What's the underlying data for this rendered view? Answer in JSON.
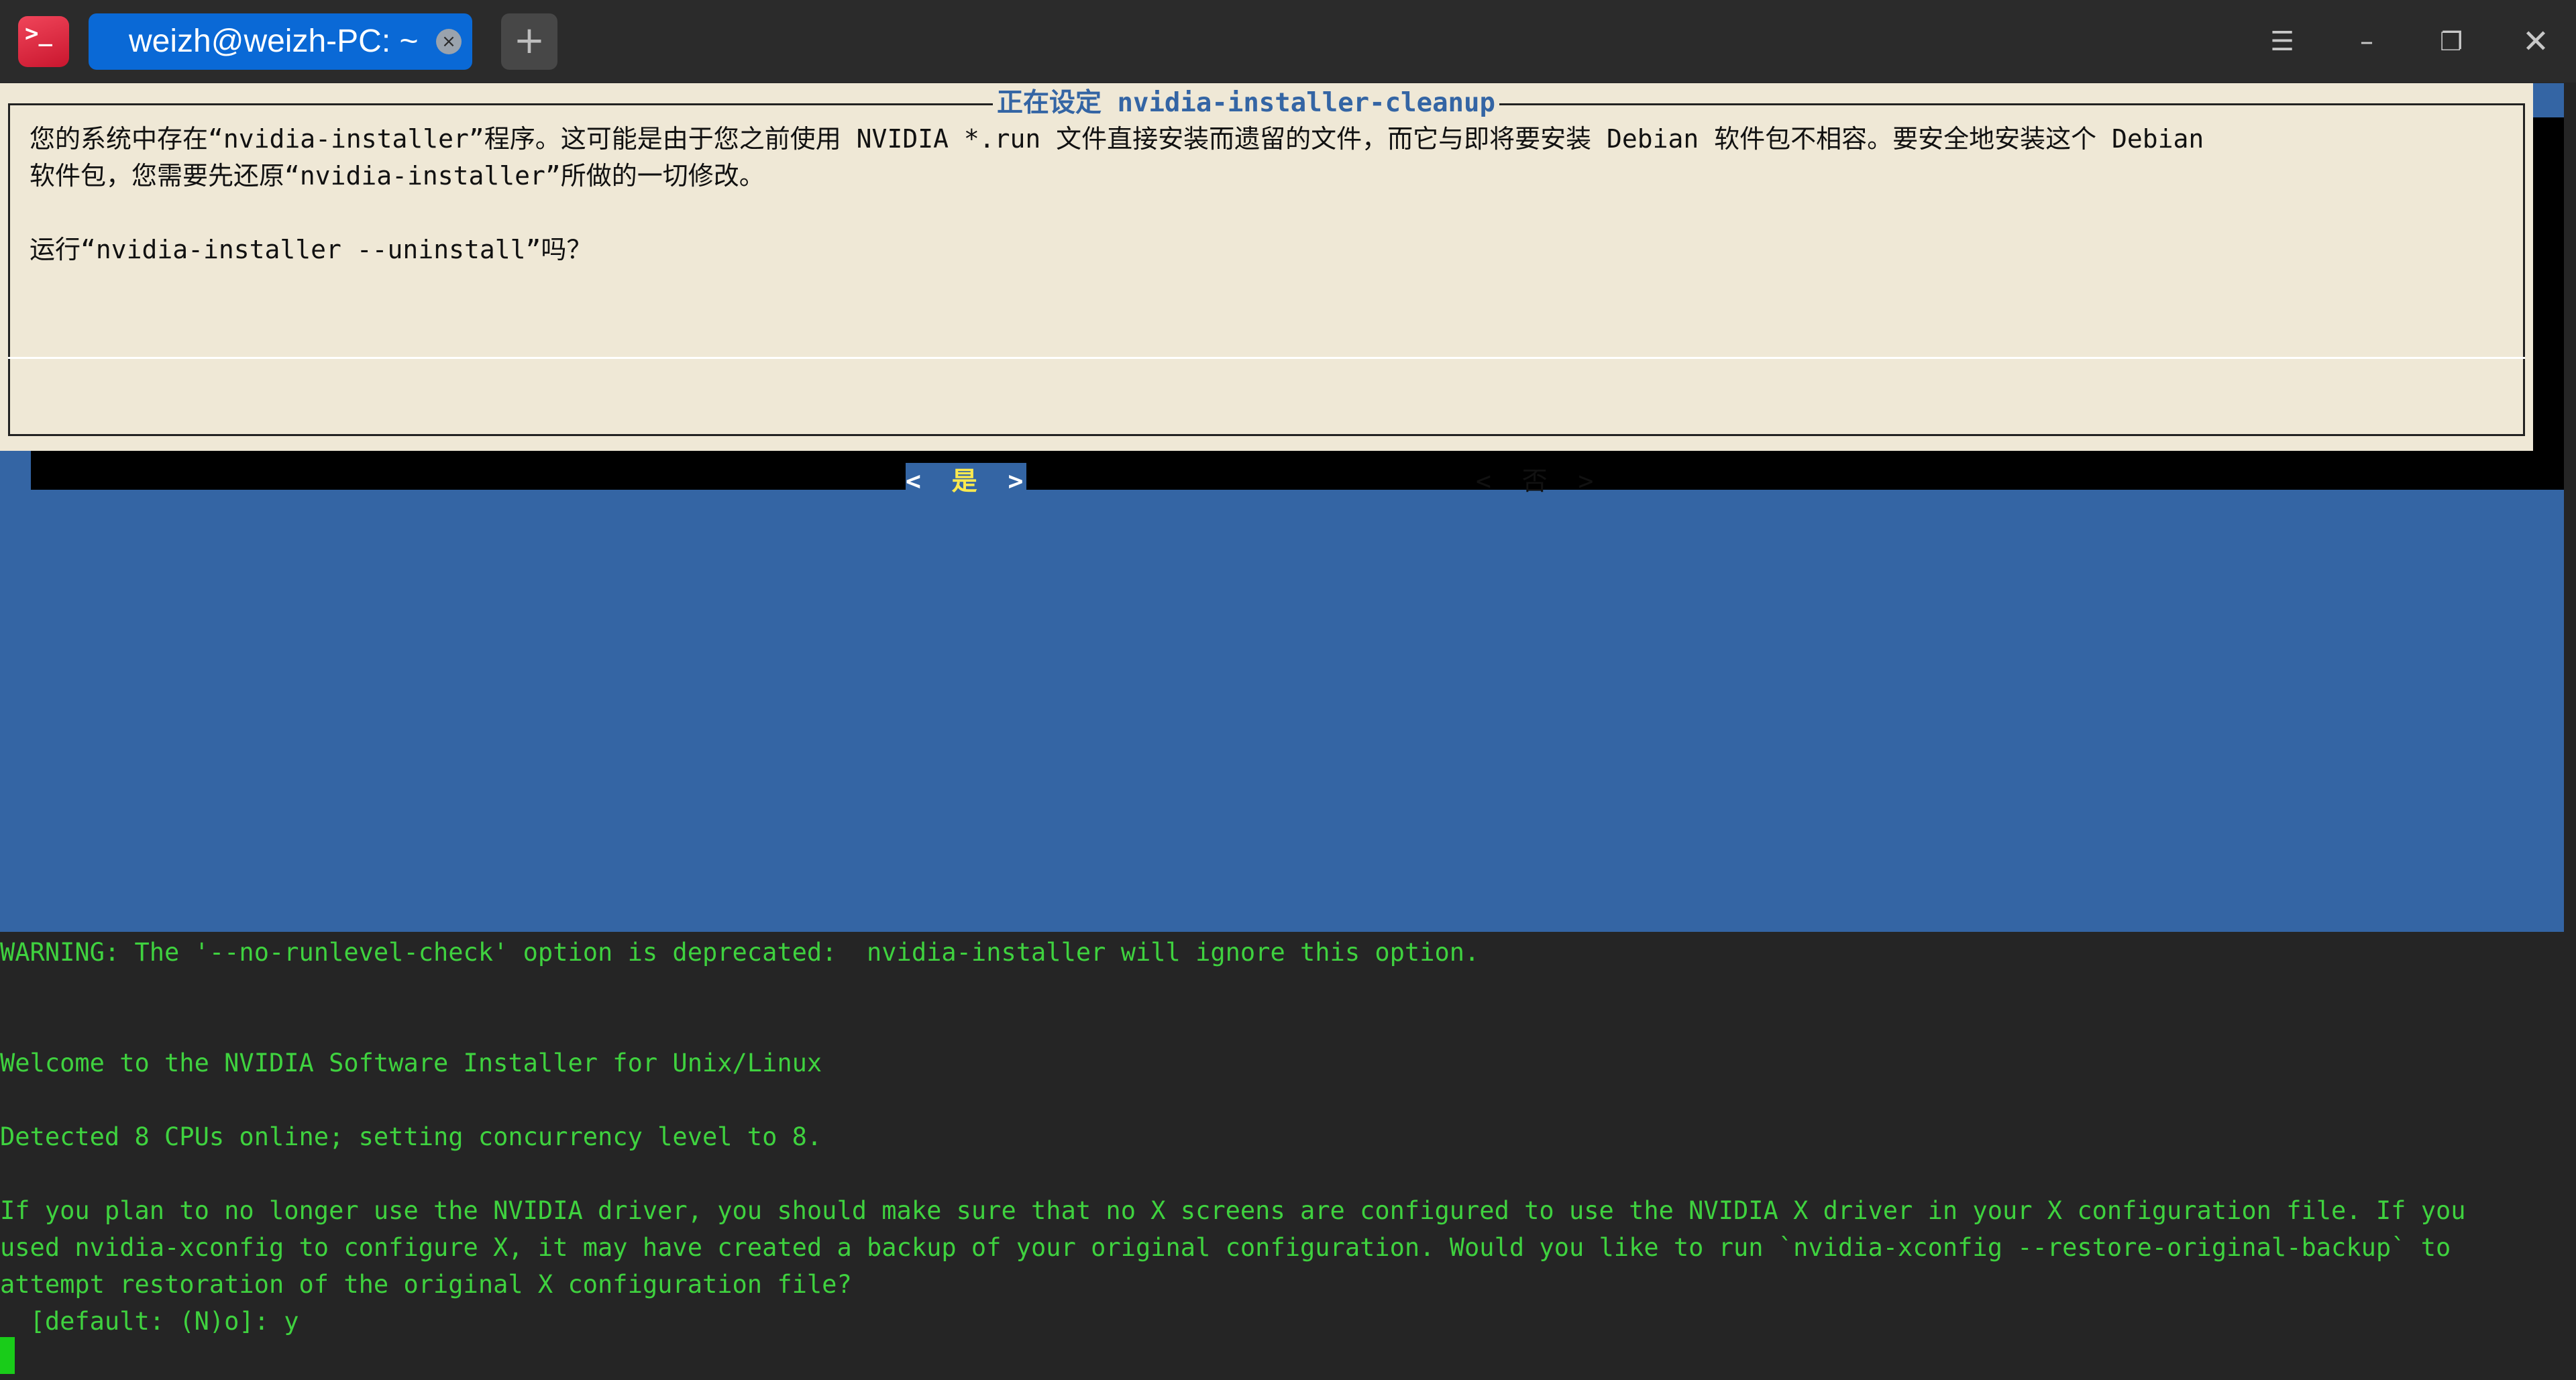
{
  "window": {
    "tab_title": "weizh@weizh-PC: ~",
    "app_icon_glyph": ">_",
    "tab_close_glyph": "×",
    "new_tab_glyph": "+",
    "menu_glyph": "☰",
    "minimize_glyph": "–",
    "maximize_glyph": "❐",
    "close_glyph": "✕"
  },
  "dialog": {
    "title": "正在设定 nvidia-installer-cleanup",
    "body_line_1": "您的系统中存在“nvidia-installer”程序。这可能是由于您之前使用 NVIDIA *.run 文件直接安装而遗留的文件，而它与即将要安装 Debian 软件包不相容。要安全地安装这个 Debian",
    "body_line_2": "软件包，您需要先还原“nvidia-installer”所做的一切修改。",
    "question": "运行“nvidia-installer --uninstall”吗？",
    "yes_label": "是",
    "no_label": "否",
    "bracket_open": "<",
    "bracket_close": ">"
  },
  "console": {
    "warning": "WARNING: The '--no-runlevel-check' option is deprecated:  nvidia-installer will ignore this option.",
    "welcome": "Welcome to the NVIDIA Software Installer for Unix/Linux",
    "cpus": "Detected 8 CPUs online; setting concurrency level to 8.",
    "question_line_1": "If you plan to no longer use the NVIDIA driver, you should make sure that no X screens are configured to use the NVIDIA X driver in your X configuration file. If you",
    "question_line_2": "used nvidia-xconfig to configure X, it may have created a backup of your original configuration. Would you like to run `nvidia-xconfig --restore-original-backup` to",
    "question_line_3": "attempt restoration of the original X configuration file?",
    "prompt": "  [default: (N)o]: y"
  },
  "colors": {
    "background": "#252525",
    "terminal_blue": "#3465a4",
    "dialog_bg": "#efe8d6",
    "console_green": "#3fd23f",
    "tab_active": "#0a69d6",
    "hotkey_yellow": "#fce94f"
  },
  "icons": {
    "app": "terminal-icon",
    "tab_close": "close-circle-icon",
    "new_tab": "plus-icon",
    "menu": "hamburger-menu-icon",
    "minimize": "minimize-icon",
    "maximize": "restore-window-icon",
    "close": "close-icon"
  }
}
